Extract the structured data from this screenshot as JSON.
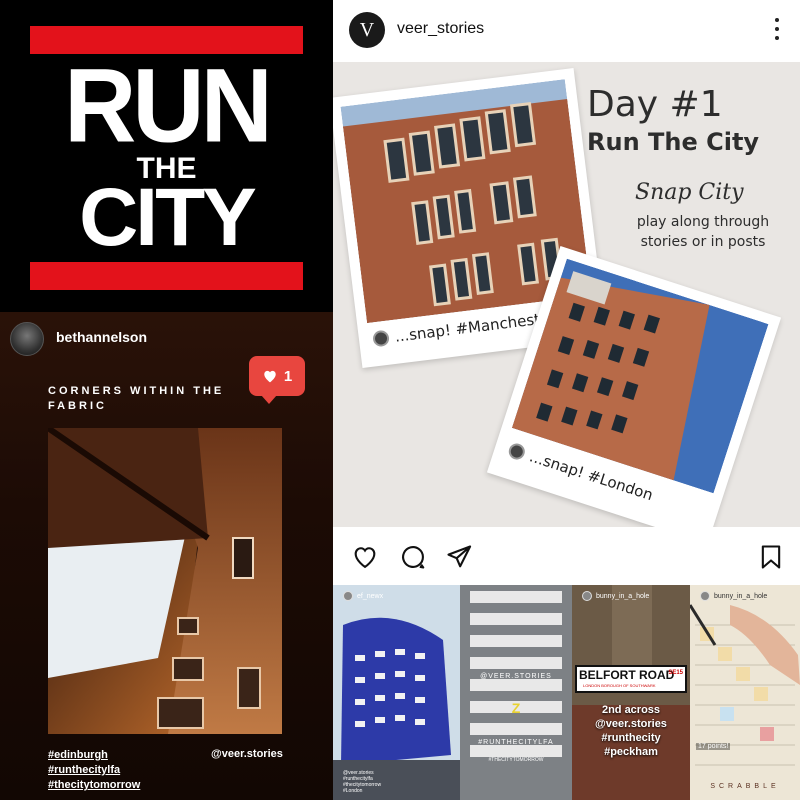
{
  "logo_tile": {
    "line1": "RUN",
    "line2": "THE",
    "line3": "CITY",
    "accent": "#e3121b"
  },
  "beth_post": {
    "username": "bethannelson",
    "like_count": "1",
    "caption": "CORNERS WITHIN THE FABRIC",
    "hashtags": [
      "#edinburgh",
      "#runthecitylfa",
      "#thecitytomorrow"
    ],
    "mention": "@veer.stories"
  },
  "main_post": {
    "username": "veer_stories",
    "avatar_letter": "V",
    "image": {
      "day": "Day #1",
      "title": "Run The City",
      "subtitle": "Snap City",
      "description": "play along through stories or in posts",
      "polaroids": [
        {
          "caption": "...snap! #Manchester"
        },
        {
          "caption": "...snap! #London"
        }
      ]
    },
    "actions": [
      "like-icon",
      "comment-icon",
      "share-icon",
      "save-icon"
    ]
  },
  "stories": [
    {
      "username": "ef_newx",
      "small_tags": "@veer.stories\n#runthecitylfa\n#thecitytomorrow\n#London"
    },
    {
      "labels": [
        "@VEER.STORIES",
        "#RUNTHECITYLFA",
        "#THECITYTOMORROW"
      ]
    },
    {
      "username": "bunny_in_a_hole",
      "sign_title": "BELFORT ROAD",
      "sign_sub": "LONDON BOROUGH OF SOUTHWARK",
      "sign_code": "SE15",
      "text": [
        "2nd across",
        "@veer.stories",
        "#runthecity",
        "#peckham"
      ]
    },
    {
      "username": "bunny_in_a_hole",
      "points": "17 points!",
      "board_label": "SCRABBLE"
    }
  ]
}
